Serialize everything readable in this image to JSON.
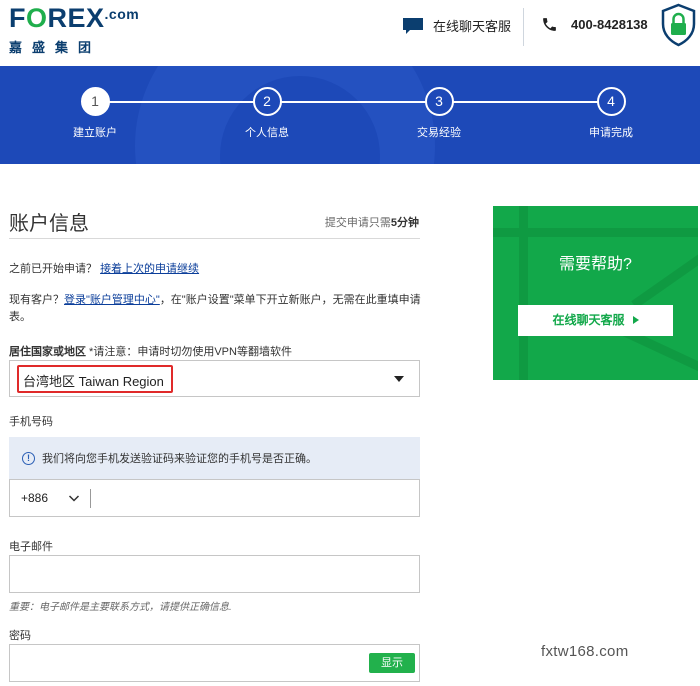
{
  "header": {
    "logo_part1": "F",
    "logo_o": "O",
    "logo_part2": "REX",
    "logo_com": ".com",
    "logo_cn": "嘉盛集团",
    "chat_label": "在线聊天客服",
    "phone_number": "400-8428138"
  },
  "steps": [
    {
      "num": "1",
      "label": "建立账户"
    },
    {
      "num": "2",
      "label": "个人信息"
    },
    {
      "num": "3",
      "label": "交易经验"
    },
    {
      "num": "4",
      "label": "申请完成"
    }
  ],
  "form": {
    "title": "账户信息",
    "time_prefix": "提交申请只需",
    "time_value": "5分钟",
    "resume_text": "之前已开始申请？",
    "resume_link": "接着上次的申请继续",
    "existing_prefix": "现有客户？",
    "existing_link": "登录\"账户管理中心\"",
    "existing_suffix": "，在\"账户设置\"菜单下开立新账户，无需在此重填申请表。",
    "country_label": "居住国家或地区",
    "country_note": " *请注意：申请时切勿使用VPN等翻墙软件",
    "country_value": "台湾地区 Taiwan Region",
    "phone_label": "手机号码",
    "phone_info": "我们将向您手机发送验证码来验证您的手机号是否正确。",
    "phone_code": "+886",
    "email_label": "电子邮件",
    "email_hint": "重要：电子邮件是主要联系方式，请提供正确信息.",
    "password_label": "密码",
    "show_button": "显示"
  },
  "help": {
    "title": "需要帮助?",
    "button": "在线聊天客服"
  },
  "watermark": "fxtw168.com",
  "colors": {
    "banner": "#1d49b8",
    "help_green": "#12a84a",
    "brand_navy": "#0b3e6f",
    "highlight_red": "#e02a2a"
  }
}
